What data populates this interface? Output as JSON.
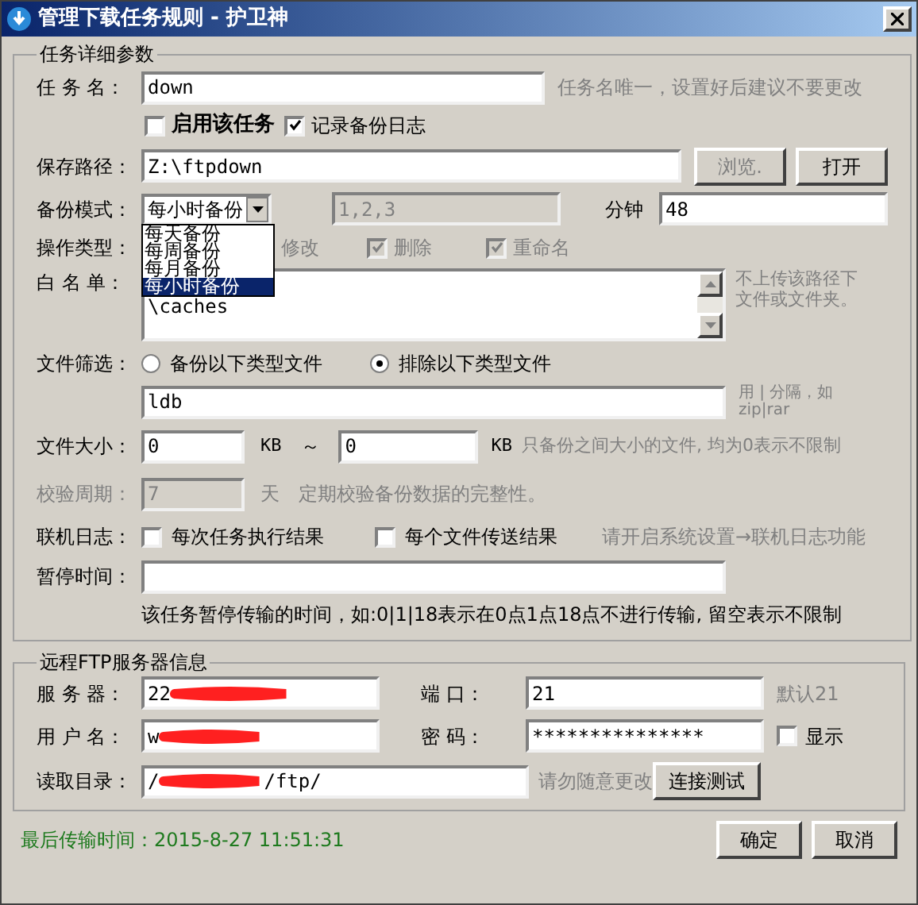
{
  "window": {
    "title": "管理下载任务规则 - 护卫神"
  },
  "task_group": {
    "title": "任务详细参数",
    "task_name": {
      "label": "任 务 名：",
      "value": "down",
      "hint": "任务名唯一，设置好后建议不要更改"
    },
    "options": [
      {
        "label": "启用该任务",
        "checked": false,
        "emphasis": true
      },
      {
        "label": "记录备份日志",
        "checked": true,
        "emphasis": false
      }
    ],
    "save_path": {
      "label": "保存路径：",
      "value": "Z:\\ftpdown",
      "buttons": [
        {
          "label": "浏览.",
          "disabled": true
        },
        {
          "label": "打开",
          "disabled": false
        }
      ]
    },
    "backup_mode": {
      "label": "备份模式：",
      "value": "每小时备份",
      "expanded": true,
      "options": [
        {
          "label": "每天备份",
          "selected": false
        },
        {
          "label": "每周备份",
          "selected": false
        },
        {
          "label": "每月备份",
          "selected": false
        },
        {
          "label": "每小时备份",
          "selected": true
        }
      ],
      "days_value": "1,2,3",
      "days_disabled": true,
      "minute_label": "分钟",
      "minute_value": "48"
    },
    "operation_type": {
      "label": "操作类型：",
      "items": [
        {
          "kind": "label",
          "label": "修改",
          "disabled": true
        },
        {
          "kind": "checkbox",
          "label": "删除",
          "checked": true,
          "disabled": true
        },
        {
          "kind": "checkbox",
          "label": "重命名",
          "checked": true,
          "disabled": true
        }
      ]
    },
    "whitelist": {
      "label": "白 名 单：",
      "lines": [
        "\\caches"
      ],
      "hint": "不上传该路径下文件或文件夹。"
    },
    "file_filter": {
      "label": "文件筛选：",
      "radios": [
        {
          "label": "备份以下类型文件",
          "selected": false
        },
        {
          "label": "排除以下类型文件",
          "selected": true
        }
      ],
      "value": "ldb",
      "hint_lines": [
        "用 | 分隔，如",
        "zip|rar"
      ]
    },
    "file_size": {
      "label": "文件大小：",
      "min": "0",
      "unit_min": "KB",
      "separator": "～",
      "max": "0",
      "unit_max": "KB",
      "hint": "只备份之间大小的文件, 均为0表示不限制"
    },
    "verify": {
      "label": "校验周期：",
      "value": "7",
      "unit": "天",
      "hint": "定期校验备份数据的完整性。",
      "disabled": true
    },
    "online_log": {
      "label": "联机日志：",
      "options": [
        {
          "label": "每次任务执行结果",
          "checked": false
        },
        {
          "label": "每个文件传送结果",
          "checked": false
        }
      ],
      "hint": "请开启系统设置→联机日志功能"
    },
    "pause": {
      "label": "暂停时间：",
      "hint": "该任务暂停传输的时间，如:0|1|18表示在0点1点18点不进行传输, 留空表示不限制"
    }
  },
  "ftp_group": {
    "title": "远程FTP服务器信息",
    "server": {
      "label": "服 务 器：",
      "value": "22"
    },
    "port": {
      "label": "端 口：",
      "value": "21",
      "hint": "默认21"
    },
    "user": {
      "label": "用 户 名：",
      "value": "w"
    },
    "password": {
      "label": "密 码：",
      "value": "***************",
      "show": {
        "label": "显示",
        "checked": false
      }
    },
    "read_dir": {
      "label": "读取目录：",
      "value_start": "/",
      "value_end": "/ftp/",
      "hint": "请勿随意更改",
      "button": "连接测试"
    }
  },
  "footer": {
    "last_transfer": "最后传输时间：2015-8-27 11:51:31",
    "buttons": [
      {
        "label": "确定"
      },
      {
        "label": "取消"
      }
    ]
  }
}
